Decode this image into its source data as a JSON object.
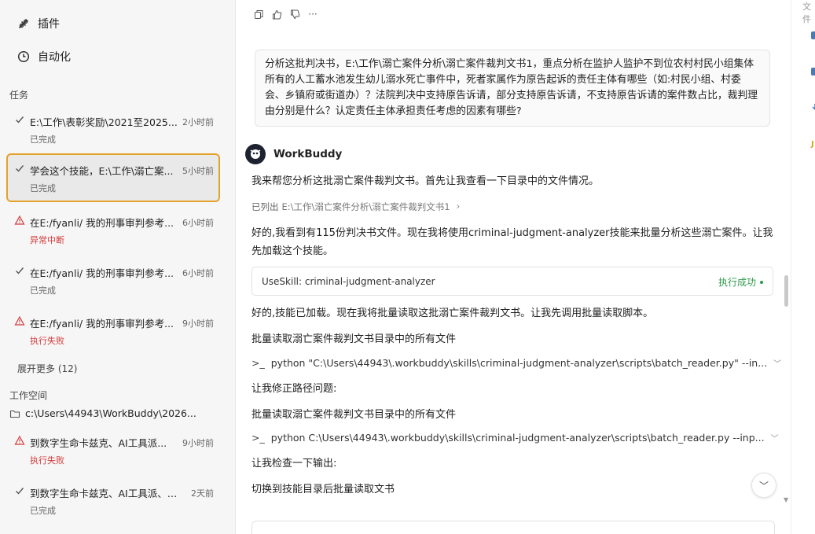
{
  "sidebar": {
    "nav": [
      {
        "label": "插件",
        "icon": "plugin-icon"
      },
      {
        "label": "自动化",
        "icon": "clock-icon"
      }
    ],
    "tasks_section": "任务",
    "tasks": [
      {
        "title": "E:\\工作\\表彰奖励\\2021至2025...",
        "time": "2小时前",
        "status": "已完成",
        "state": "done"
      },
      {
        "title": "学会这个技能，E:\\工作\\溺亡案...",
        "time": "5小时前",
        "status": "已完成",
        "state": "done"
      },
      {
        "title": "在E:/fyanli/ 我的刑事审判参考...",
        "time": "6小时前",
        "status": "异常中断",
        "state": "error"
      },
      {
        "title": "在E:/fyanli/ 我的刑事审判参考...",
        "time": "6小时前",
        "status": "已完成",
        "state": "done"
      },
      {
        "title": "在E:/fyanli/ 我的刑事审判参考...",
        "time": "9小时前",
        "status": "执行失败",
        "state": "error"
      }
    ],
    "expand_more": "展开更多 (12)",
    "workspace_section": "工作空间",
    "workspace_path": "c:\\Users\\44943\\WorkBuddy\\2026...",
    "workspace_tasks": [
      {
        "title": "到数字生命卡兹克、AI工具派...",
        "time": "9小时前",
        "status": "执行失败",
        "state": "error"
      },
      {
        "title": "到数字生命卡兹克、AI工具派、A...",
        "time": "2天前",
        "status": "已完成",
        "state": "done"
      }
    ]
  },
  "main": {
    "user_message": "分析这批判决书，E:\\工作\\溺亡案件分析\\溺亡案件裁判文书1，重点分析在监护人监护不到位农村村民小组集体所有的人工蓄水池发生幼儿溺水死亡事件中，死者家属作为原告起诉的责任主体有哪些（如:村民小组、村委会、乡镇府或街道办）？法院判决中支持原告诉请，部分支持原告诉请，不支持原告诉请的案件数占比，裁判理由分别是什么？认定责任主体承担责任考虑的因素有哪些?",
    "bot_name": "WorkBuddy",
    "p1": "我来帮您分析这批溺亡案件裁判文书。首先让我查看一下目录中的文件情况。",
    "listed_label": "已列出",
    "listed_path": "E:\\工作\\溺亡案件分析\\溺亡案件裁判文书1",
    "p2": "好的,我看到有115份判决书文件。现在我将使用criminal-judgment-analyzer技能来批量分析这些溺亡案件。让我先加载这个技能。",
    "skill_label": "UseSkill: criminal-judgment-analyzer",
    "skill_status": "执行成功",
    "p3": "好的,技能已加载。现在我将批量读取这批溺亡案件裁判文书。让我先调用批量读取脚本。",
    "h1": "批量读取溺亡案件裁判文书目录中的所有文件",
    "cmd1": "python \"C:\\Users\\44943\\.workbuddy\\skills\\criminal-judgment-analyzer\\scripts\\batch_reader.py\" --in...",
    "p4": "让我修正路径问题:",
    "h2": "批量读取溺亡案件裁判文书目录中的所有文件",
    "cmd2": "python C:\\Users\\44943\\.workbuddy\\skills\\criminal-judgment-analyzer\\scripts\\batch_reader.py --inp...",
    "p5": "让我检查一下输出:",
    "h3": "切换到技能目录后批量读取文书"
  },
  "right_panel": {
    "label": "文件"
  },
  "colors": {
    "accent_border": "#e3a32b",
    "success": "#2f9a4c",
    "error": "#d23b3b"
  }
}
